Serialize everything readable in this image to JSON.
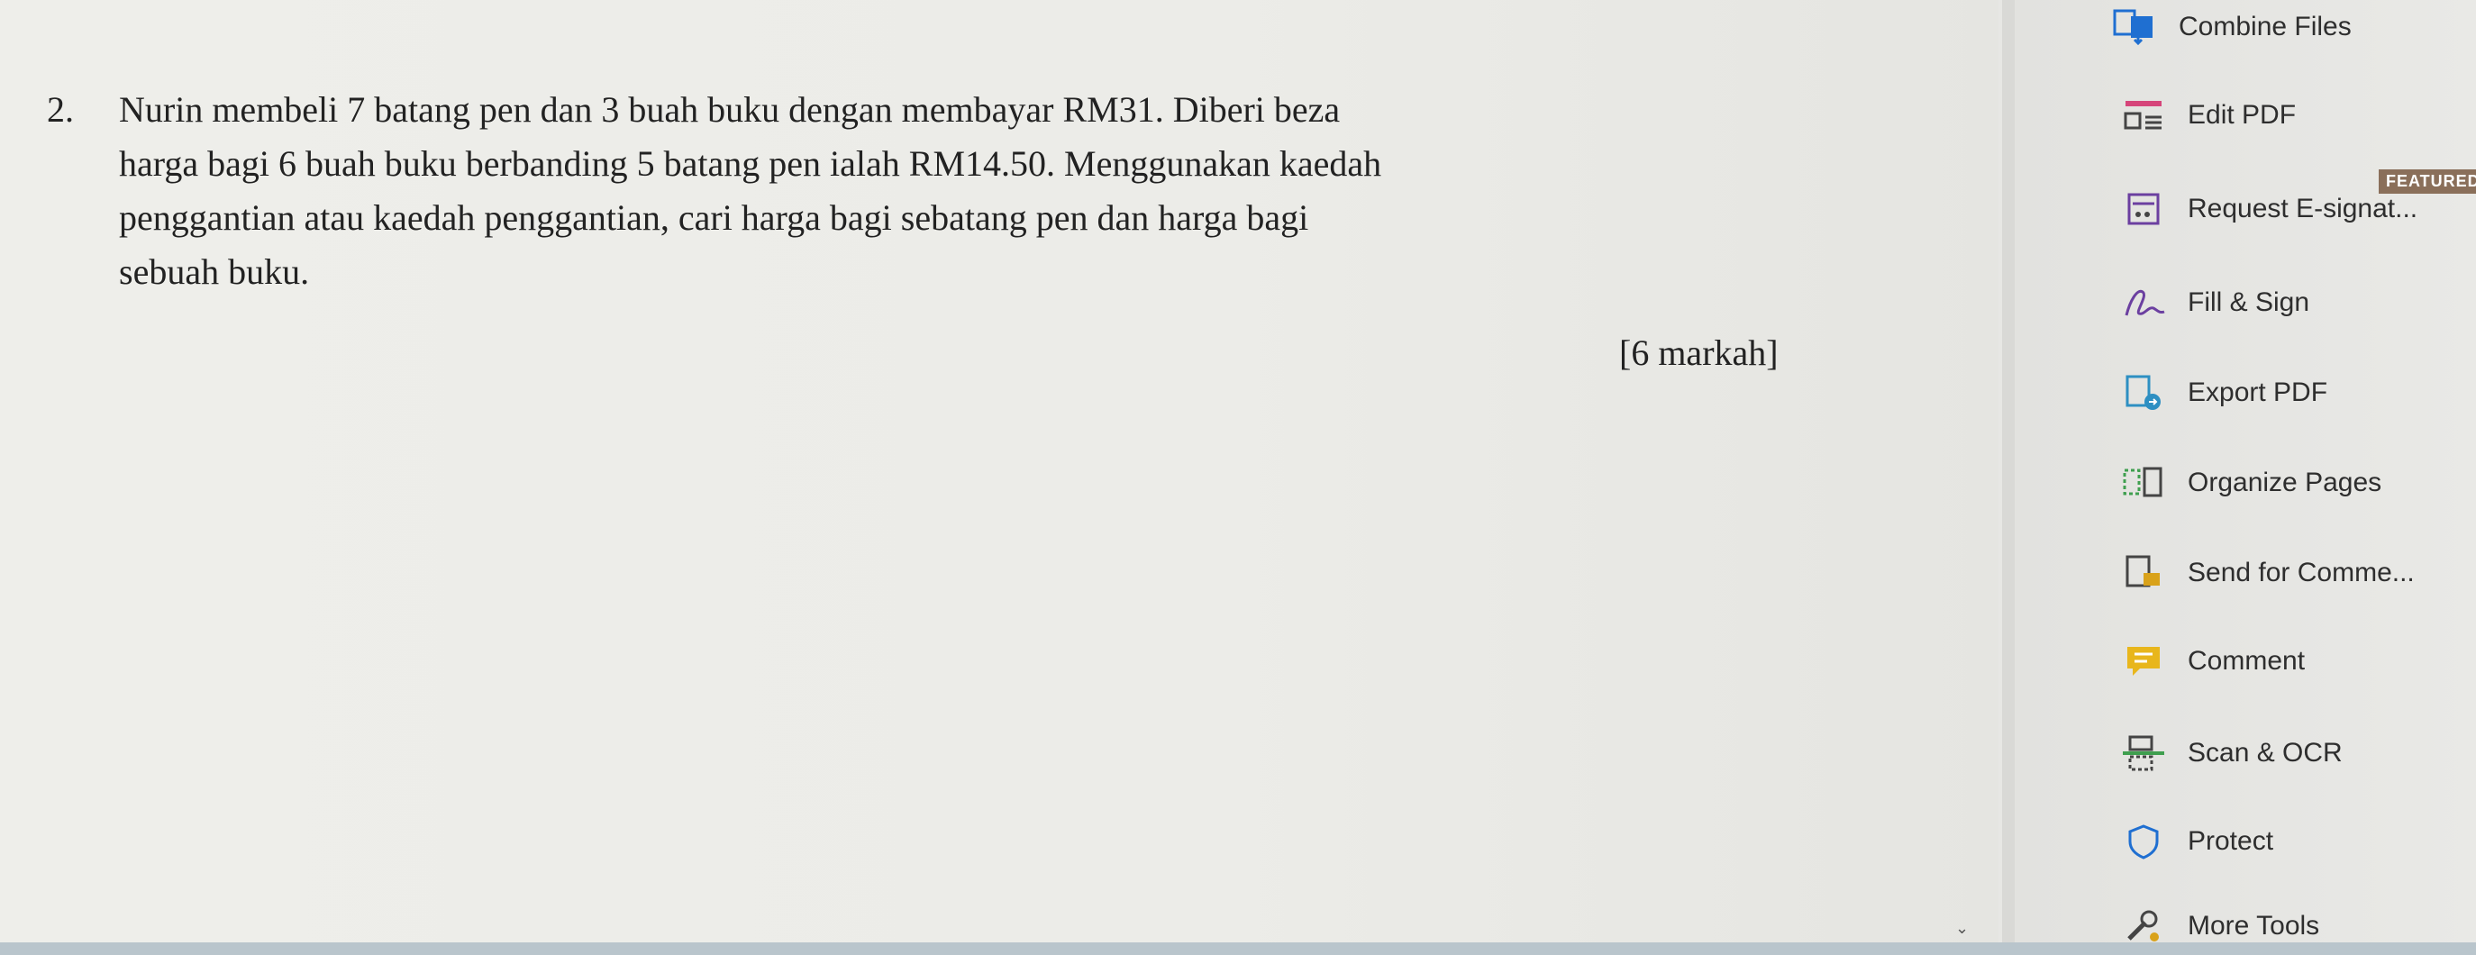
{
  "question": {
    "number": "2.",
    "lines": [
      "Nurin membeli 7 batang pen dan 3 buah buku dengan membayar RM31. Diberi beza",
      "harga bagi 6 buah buku berbanding 5 batang pen ialah RM14.50. Menggunakan kaedah",
      "penggantian atau kaedah penggantian, cari harga bagi sebatang pen dan harga bagi",
      "sebuah buku."
    ],
    "marks": "[6 markah]"
  },
  "tools": [
    {
      "label": "Combine Files",
      "icon": "combine-files-icon"
    },
    {
      "label": "Edit PDF",
      "icon": "edit-pdf-icon"
    },
    {
      "label": "Request E-signat...",
      "icon": "request-esign-icon",
      "badge": "FEATURED"
    },
    {
      "label": "Fill & Sign",
      "icon": "fill-sign-icon"
    },
    {
      "label": "Export PDF",
      "icon": "export-pdf-icon"
    },
    {
      "label": "Organize Pages",
      "icon": "organize-pages-icon"
    },
    {
      "label": "Send for Comme...",
      "icon": "send-for-comment-icon"
    },
    {
      "label": "Comment",
      "icon": "comment-icon"
    },
    {
      "label": "Scan & OCR",
      "icon": "scan-ocr-icon"
    },
    {
      "label": "Protect",
      "icon": "protect-icon"
    },
    {
      "label": "More Tools",
      "icon": "more-tools-icon"
    }
  ],
  "colors": {
    "combine": "#1f6fd1",
    "edit": "#d6457a",
    "esign": "#6b3fa0",
    "fill": "#6b3fa0",
    "export": "#2d8fc2",
    "organize": "#3f9f4f",
    "send": "#d9a21a",
    "comment": "#e8b61c",
    "scan": "#3f9f4f",
    "protect": "#1f6fd1"
  }
}
